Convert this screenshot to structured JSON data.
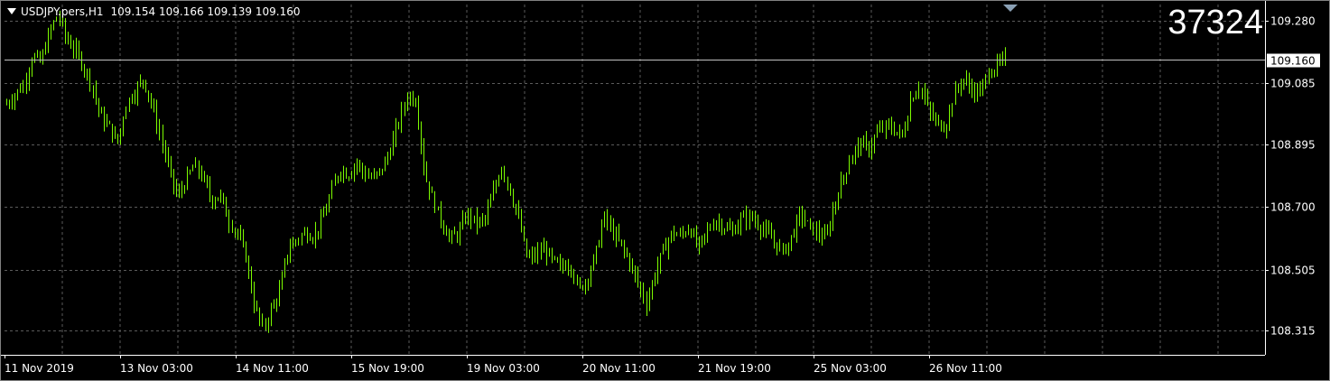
{
  "header": {
    "symbol_label": "USDJPY.pers,H1",
    "ohlc": "109.154 109.166 109.139 109.160"
  },
  "overlay_number": "37324",
  "colors": {
    "background": "#000000",
    "grid": "#5a5a5a",
    "candle": "#7CFC00",
    "text": "#ffffff",
    "price_line": "#c0c0c0",
    "marker": "#8aa0b4"
  },
  "chart_data": {
    "type": "candlestick",
    "title": "USDJPY.pers,H1",
    "grid": true,
    "y_ticks": [
      "109.280",
      "109.085",
      "108.895",
      "108.700",
      "108.505",
      "108.315"
    ],
    "current_price": "109.160",
    "x_ticks": [
      "11 Nov 2019",
      "13 Nov 03:00",
      "14 Nov 11:00",
      "15 Nov 19:00",
      "19 Nov 03:00",
      "20 Nov 11:00",
      "21 Nov 19:00",
      "25 Nov 03:00",
      "26 Nov 11:00"
    ],
    "ylim": [
      108.24,
      109.33
    ],
    "close_path": [
      109.02,
      109.05,
      109.08,
      109.17,
      109.15,
      109.24,
      109.3,
      109.22,
      109.19,
      109.14,
      109.08,
      108.98,
      108.95,
      108.9,
      109.02,
      109.06,
      109.1,
      109.02,
      108.92,
      108.82,
      108.73,
      108.78,
      108.83,
      108.79,
      108.72,
      108.74,
      108.66,
      108.62,
      108.55,
      108.4,
      108.32,
      108.38,
      108.44,
      108.57,
      108.6,
      108.62,
      108.61,
      108.66,
      108.74,
      108.82,
      108.8,
      108.84,
      108.8,
      108.79,
      108.82,
      108.88,
      108.97,
      109.05,
      109.03,
      108.8,
      108.72,
      108.65,
      108.6,
      108.62,
      108.68,
      108.65,
      108.66,
      108.74,
      108.83,
      108.75,
      108.66,
      108.54,
      108.55,
      108.57,
      108.53,
      108.51,
      108.53,
      108.44,
      108.48,
      108.55,
      108.67,
      108.62,
      108.58,
      108.53,
      108.46,
      108.4,
      108.5,
      108.57,
      108.62,
      108.61,
      108.64,
      108.57,
      108.62,
      108.66,
      108.64,
      108.62,
      108.66,
      108.67,
      108.65,
      108.62,
      108.59,
      108.56,
      108.61,
      108.68,
      108.64,
      108.62,
      108.6,
      108.71,
      108.79,
      108.86,
      108.9,
      108.88,
      108.93,
      108.95,
      108.94,
      108.92,
      109.04,
      109.08,
      109.0,
      108.96,
      108.95,
      109.05,
      109.1,
      109.07,
      109.05,
      109.12,
      109.14,
      109.16
    ]
  }
}
